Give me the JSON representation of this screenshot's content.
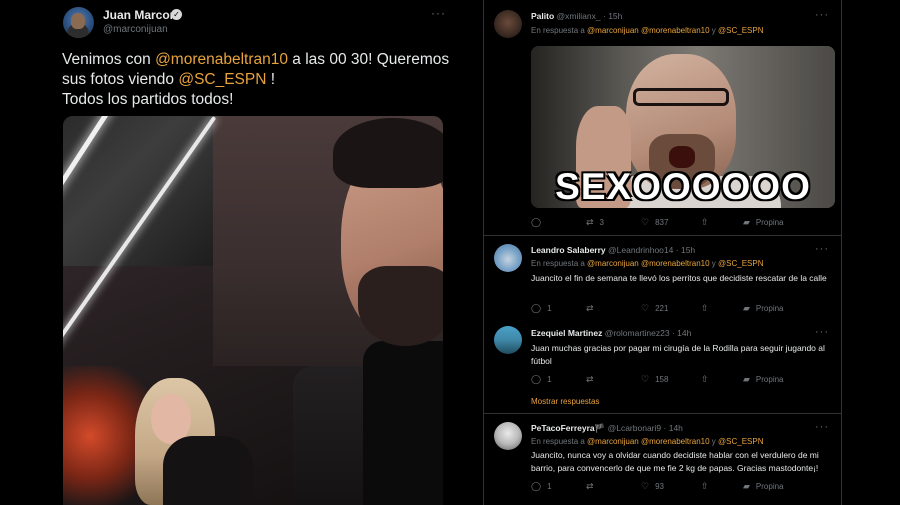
{
  "left_tweet": {
    "author_name": "Juan Marconi",
    "author_handle": "@marconijuan",
    "more": "···",
    "text_part1": "Venimos con ",
    "mention1": "@morenabeltran10",
    "text_part2": " a las 00 30! Queremos sus fotos viendo ",
    "mention2": "@SC_ESPN",
    "text_part3": " !",
    "text_line2": "Todos los partidos todos!",
    "verified_glyph": "✓",
    "accent_color": "#e8a33d"
  },
  "replies": [
    {
      "author_name": "Palito",
      "author_handle": "@xmilianx_",
      "time": "15h",
      "more": "···",
      "reply_prefix": "En respuesta a ",
      "reply_mentions": "@marconijuan @morenabeltran10",
      "reply_conj": " y ",
      "reply_mention2": "@SC_ESPN",
      "gif_caption": "SEXOOOOOO",
      "replies_count": "",
      "retweets": "3",
      "likes": "837",
      "promo": "Propina"
    },
    {
      "author_name": "Leandro Salaberry",
      "author_handle": "@Leandrinhoo14",
      "time": "15h",
      "more": "···",
      "reply_prefix": "En respuesta a ",
      "reply_mentions": "@marconijuan @morenabeltran10",
      "reply_conj": " y ",
      "reply_mention2": "@SC_ESPN",
      "text": "Juancito el fin de semana te llevó los perritos que decidiste rescatar de la calle",
      "replies_count": "1",
      "retweets": "",
      "likes": "221",
      "promo": "Propina"
    },
    {
      "author_name": "Ezequiel Martinez",
      "author_handle": "@rolomartinez23",
      "time": "14h",
      "more": "···",
      "text": "Juan muchas gracias por pagar mi cirugía de la Rodilla para seguir jugando al fútbol",
      "replies_count": "1",
      "retweets": "",
      "likes": "158",
      "promo": "Propina",
      "show_more": "Mostrar respuestas"
    },
    {
      "author_name": "PeTacoFerreyra🏴",
      "author_handle": "@Lcarbonari9",
      "time": "14h",
      "more": "···",
      "reply_prefix": "En respuesta a ",
      "reply_mentions": "@marconijuan @morenabeltran10",
      "reply_conj": " y ",
      "reply_mention2": "@SC_ESPN",
      "text": "Juancito, nunca voy a olvidar cuando decidiste hablar con el verdulero de mi barrio, para convencerlo de que me fie 2 kg de papas. Gracias mastodonte¡!",
      "replies_count": "1",
      "retweets": "",
      "likes": "93",
      "promo": "Propina"
    }
  ],
  "icons": {
    "reply": "reply-icon",
    "retweet": "retweet-icon",
    "like": "heart-icon",
    "share": "share-icon",
    "tip": "tip-icon"
  }
}
